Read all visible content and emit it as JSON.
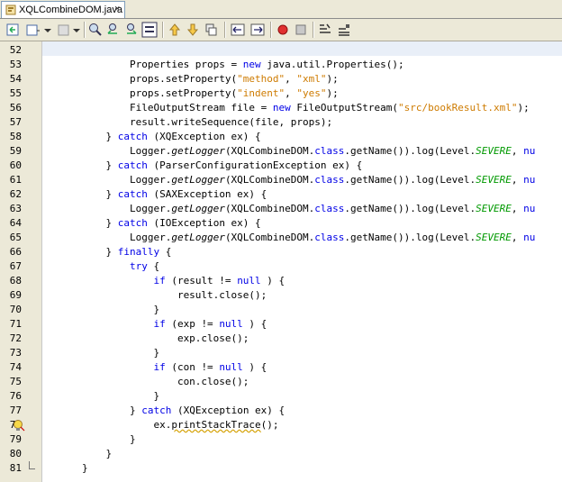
{
  "tab": {
    "label": "XQLCombineDOM.java",
    "close": "×",
    "icon": "java-file-icon"
  },
  "toolbar": {
    "icons": [
      "back-icon",
      "history-icon",
      "find-icon",
      "find-prev-icon",
      "find-next-icon",
      "toggle-highlight-icon",
      "shift-up-icon",
      "shift-down-icon",
      "next-bookmark-icon",
      "shift-left-icon",
      "shift-right-icon",
      "record-macro-icon",
      "stop-macro-icon",
      "comment-icon",
      "uncomment-icon"
    ]
  },
  "lines": [
    {
      "n": "52",
      "t": []
    },
    {
      "n": "53",
      "t": [
        [
          "",
          "                Properties props = "
        ],
        [
          "kw",
          "new"
        ],
        [
          "",
          " java.util.Properties();"
        ]
      ]
    },
    {
      "n": "54",
      "t": [
        [
          "",
          "                props.setProperty("
        ],
        [
          "str",
          "\"method\""
        ],
        [
          "",
          ", "
        ],
        [
          "str",
          "\"xml\""
        ],
        [
          "",
          ");"
        ]
      ]
    },
    {
      "n": "55",
      "t": [
        [
          "",
          "                props.setProperty("
        ],
        [
          "str",
          "\"indent\""
        ],
        [
          "",
          ", "
        ],
        [
          "str",
          "\"yes\""
        ],
        [
          "",
          ");"
        ]
      ]
    },
    {
      "n": "56",
      "t": [
        [
          "",
          "                FileOutputStream file = "
        ],
        [
          "kw",
          "new"
        ],
        [
          "",
          " FileOutputStream("
        ],
        [
          "str",
          "\"src/bookResult.xml\""
        ],
        [
          "",
          ");"
        ]
      ]
    },
    {
      "n": "57",
      "t": [
        [
          "",
          "                result.writeSequence(file, props);"
        ]
      ]
    },
    {
      "n": "58",
      "t": [
        [
          "",
          "            } "
        ],
        [
          "kw",
          "catch"
        ],
        [
          "",
          " (XQException ex) {"
        ]
      ]
    },
    {
      "n": "59",
      "t": [
        [
          "",
          "                Logger."
        ],
        [
          "it",
          "getLogger"
        ],
        [
          "",
          "(XQLCombineDOM."
        ],
        [
          "kw",
          "class"
        ],
        [
          "",
          ".getName()).log(Level."
        ],
        [
          "st",
          "SEVERE"
        ],
        [
          "",
          ", "
        ],
        [
          "kw",
          "nu"
        ]
      ]
    },
    {
      "n": "60",
      "t": [
        [
          "",
          "            } "
        ],
        [
          "kw",
          "catch"
        ],
        [
          "",
          " (ParserConfigurationException ex) {"
        ]
      ]
    },
    {
      "n": "61",
      "t": [
        [
          "",
          "                Logger."
        ],
        [
          "it",
          "getLogger"
        ],
        [
          "",
          "(XQLCombineDOM."
        ],
        [
          "kw",
          "class"
        ],
        [
          "",
          ".getName()).log(Level."
        ],
        [
          "st",
          "SEVERE"
        ],
        [
          "",
          ", "
        ],
        [
          "kw",
          "nu"
        ]
      ]
    },
    {
      "n": "62",
      "t": [
        [
          "",
          "            } "
        ],
        [
          "kw",
          "catch"
        ],
        [
          "",
          " (SAXException ex) {"
        ]
      ]
    },
    {
      "n": "63",
      "t": [
        [
          "",
          "                Logger."
        ],
        [
          "it",
          "getLogger"
        ],
        [
          "",
          "(XQLCombineDOM."
        ],
        [
          "kw",
          "class"
        ],
        [
          "",
          ".getName()).log(Level."
        ],
        [
          "st",
          "SEVERE"
        ],
        [
          "",
          ", "
        ],
        [
          "kw",
          "nu"
        ]
      ]
    },
    {
      "n": "64",
      "t": [
        [
          "",
          "            } "
        ],
        [
          "kw",
          "catch"
        ],
        [
          "",
          " (IOException ex) {"
        ]
      ]
    },
    {
      "n": "65",
      "t": [
        [
          "",
          "                Logger."
        ],
        [
          "it",
          "getLogger"
        ],
        [
          "",
          "(XQLCombineDOM."
        ],
        [
          "kw",
          "class"
        ],
        [
          "",
          ".getName()).log(Level."
        ],
        [
          "st",
          "SEVERE"
        ],
        [
          "",
          ", "
        ],
        [
          "kw",
          "nu"
        ]
      ]
    },
    {
      "n": "66",
      "t": [
        [
          "",
          "            } "
        ],
        [
          "kw",
          "finally"
        ],
        [
          "",
          " {"
        ]
      ]
    },
    {
      "n": "67",
      "t": [
        [
          "",
          "                "
        ],
        [
          "kw",
          "try"
        ],
        [
          "",
          " {"
        ]
      ]
    },
    {
      "n": "68",
      "t": [
        [
          "",
          "                    "
        ],
        [
          "kw",
          "if"
        ],
        [
          "",
          " (result != "
        ],
        [
          "kw",
          "null"
        ],
        [
          "",
          " ) {"
        ]
      ]
    },
    {
      "n": "69",
      "t": [
        [
          "",
          "                        result.close();"
        ]
      ]
    },
    {
      "n": "70",
      "t": [
        [
          "",
          "                    }"
        ]
      ]
    },
    {
      "n": "71",
      "t": [
        [
          "",
          "                    "
        ],
        [
          "kw",
          "if"
        ],
        [
          "",
          " (exp != "
        ],
        [
          "kw",
          "null"
        ],
        [
          "",
          " ) {"
        ]
      ]
    },
    {
      "n": "72",
      "t": [
        [
          "",
          "                        exp.close();"
        ]
      ]
    },
    {
      "n": "73",
      "t": [
        [
          "",
          "                    }"
        ]
      ]
    },
    {
      "n": "74",
      "t": [
        [
          "",
          "                    "
        ],
        [
          "kw",
          "if"
        ],
        [
          "",
          " (con != "
        ],
        [
          "kw",
          "null"
        ],
        [
          "",
          " ) {"
        ]
      ]
    },
    {
      "n": "75",
      "t": [
        [
          "",
          "                        con.close();"
        ]
      ]
    },
    {
      "n": "76",
      "t": [
        [
          "",
          "                    }"
        ]
      ]
    },
    {
      "n": "77",
      "t": [
        [
          "",
          "                } "
        ],
        [
          "kw",
          "catch"
        ],
        [
          "",
          " (XQException ex) {"
        ]
      ]
    },
    {
      "n": "78",
      "t": [
        [
          "",
          "                    ex."
        ],
        [
          "sq",
          "printStackTrace"
        ],
        [
          "",
          "();"
        ]
      ]
    },
    {
      "n": "79",
      "t": [
        [
          "",
          "                }"
        ]
      ]
    },
    {
      "n": "80",
      "t": [
        [
          "",
          "            }"
        ]
      ]
    },
    {
      "n": "81",
      "t": [
        [
          "",
          "        }"
        ]
      ]
    }
  ]
}
